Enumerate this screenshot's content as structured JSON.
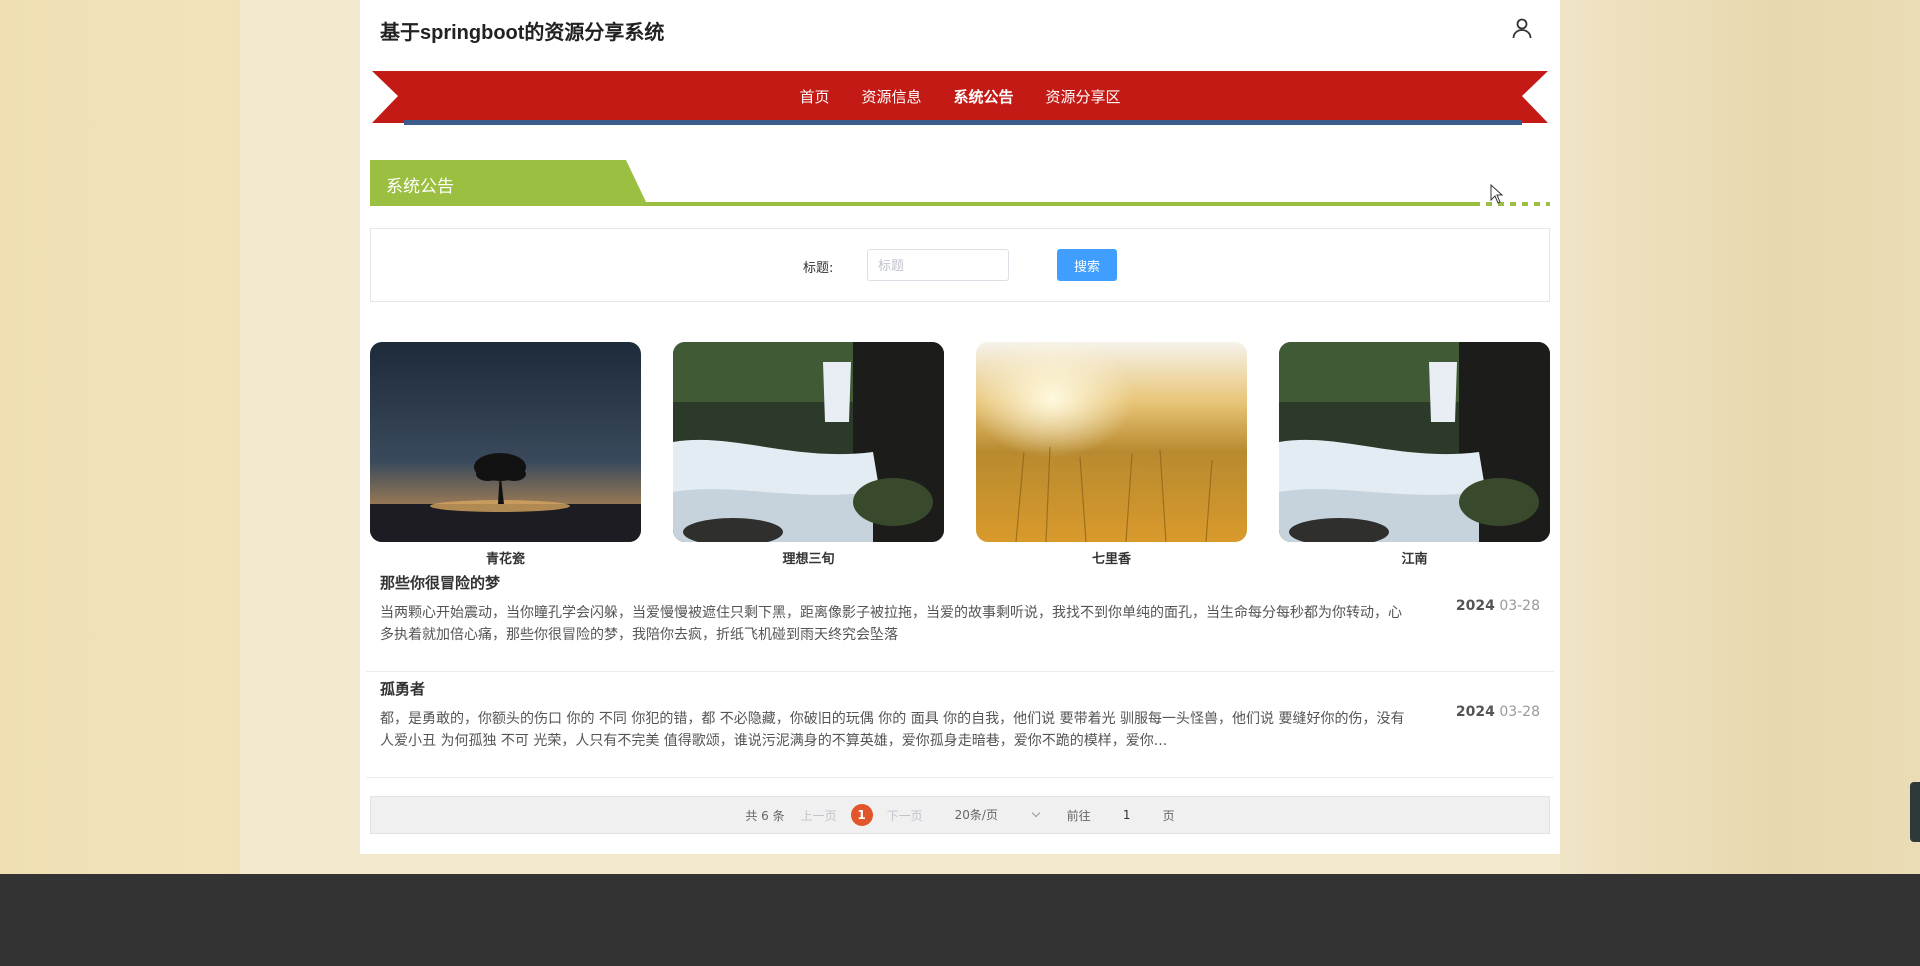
{
  "header": {
    "site_title": "基于springboot的资源分享系统",
    "user_icon": "user-icon"
  },
  "nav": {
    "items": [
      {
        "label": "首页",
        "active": false
      },
      {
        "label": "资源信息",
        "active": false
      },
      {
        "label": "系统公告",
        "active": true
      },
      {
        "label": "资源分享区",
        "active": false
      }
    ],
    "ribbon_color": "#c41a16",
    "accent_color": "#3c5a8a"
  },
  "section": {
    "title": "系统公告",
    "color": "#9bc041"
  },
  "search": {
    "label": "标题:",
    "placeholder": "标题",
    "value": "",
    "button_label": "搜索"
  },
  "gallery": [
    {
      "caption": "青花瓷",
      "image": "night-tree"
    },
    {
      "caption": "理想三旬",
      "image": "waterfall"
    },
    {
      "caption": "七里香",
      "image": "wheat-field"
    },
    {
      "caption": "江南",
      "image": "waterfall"
    }
  ],
  "notices": [
    {
      "title": "那些你很冒险的梦",
      "body": "当两颗心开始震动，当你瞳孔学会闪躲，当爱慢慢被遮住只剩下黑，距离像影子被拉拖，当爱的故事剩听说，我找不到你单纯的面孔，当生命每分每秒都为你转动，心多执着就加倍心痛，那些你很冒险的梦，我陪你去疯，折纸飞机碰到雨天终究会坠落",
      "date_year": "2024",
      "date_md": "03-28"
    },
    {
      "title": "孤勇者",
      "body": "都，是勇敢的，你额头的伤口 你的 不同 你犯的错，都 不必隐藏，你破旧的玩偶 你的 面具 你的自我，他们说 要带着光 驯服每一头怪兽，他们说 要缝好你的伤，没有人爱小丑 为何孤独 不可 光荣，人只有不完美 值得歌颂，谁说污泥满身的不算英雄，爱你孤身走暗巷，爱你不跪的模样，爱你...",
      "date_year": "2024",
      "date_md": "03-28"
    }
  ],
  "pagination": {
    "total": "共 6 条",
    "prev": "上一页",
    "current": "1",
    "next": "下一页",
    "page_size": "20条/页",
    "goto_label": "前往",
    "goto_value": "1",
    "page_suffix": "页"
  }
}
